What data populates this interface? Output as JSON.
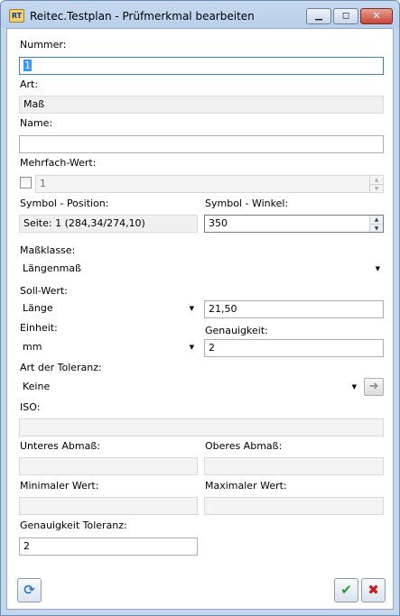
{
  "window": {
    "title": "Reitec.Testplan - Prüfmerkmal bearbeiten",
    "app_icon_label": "RT"
  },
  "icons": {
    "app": "testplan-app-icon",
    "minimize": "minimize-icon",
    "maximize": "maximize-icon",
    "close": "close-icon",
    "refresh": "refresh-icon",
    "ok": "checkmark-icon",
    "cancel": "cancel-x-icon",
    "apply_tolerance": "arrow-right-icon"
  },
  "colors": {
    "ok_green": "#2f9a2f",
    "cancel_red": "#c8201c",
    "refresh_blue": "#2d7ad0",
    "selection": "#3399ff"
  },
  "form": {
    "nummer": {
      "label": "Nummer:",
      "value": "1"
    },
    "art": {
      "label": "Art:",
      "value": "Maß"
    },
    "name": {
      "label": "Name:",
      "value": ""
    },
    "mehrfach": {
      "label": "Mehrfach-Wert:",
      "checked": false,
      "value": "1"
    },
    "symbol_position": {
      "label": "Symbol - Position:",
      "value": "Seite: 1 (284,34/274,10)"
    },
    "symbol_winkel": {
      "label": "Symbol - Winkel:",
      "value": "350"
    },
    "massklasse": {
      "label": "Maßklasse:",
      "value": "Längenmaß"
    },
    "soll_wert": {
      "label": "Soll-Wert:",
      "type_value": "Länge",
      "value": "21,50"
    },
    "einheit": {
      "label": "Einheit:",
      "value": "mm"
    },
    "genauigkeit": {
      "label": "Genauigkeit:",
      "value": "2"
    },
    "art_toleranz": {
      "label": "Art der Toleranz:",
      "value": "Keine"
    },
    "iso": {
      "label": "ISO:",
      "value": ""
    },
    "unteres_abmass": {
      "label": "Unteres Abmaß:",
      "value": ""
    },
    "oberes_abmass": {
      "label": "Oberes Abmaß:",
      "value": ""
    },
    "minimaler_wert": {
      "label": "Minimaler Wert:",
      "value": ""
    },
    "maximaler_wert": {
      "label": "Maximaler Wert:",
      "value": ""
    },
    "genauigkeit_toleranz": {
      "label": "Genauigkeit Toleranz:",
      "value": "2"
    }
  },
  "glyphs": {
    "minimize": "▁",
    "maximize": "◻",
    "close": "✕",
    "combo": "▼",
    "spin_up": "▲",
    "spin_down": "▼",
    "arrow_right": "➜",
    "refresh": "⟳",
    "ok": "✔",
    "cancel": "✖"
  }
}
